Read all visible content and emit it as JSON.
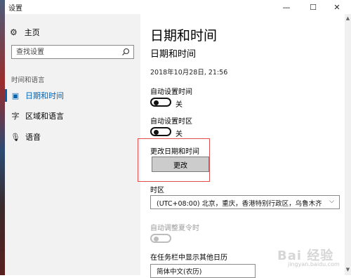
{
  "window": {
    "title": "设置",
    "controls": {
      "minimize": "—",
      "maximize": "☐",
      "close": "✕"
    }
  },
  "sidebar": {
    "home_label": "主页",
    "search": {
      "placeholder": "查找设置"
    },
    "section_label": "时间和语言",
    "items": [
      {
        "label": "日期和时间",
        "icon": "calendar-clock-icon",
        "active": true
      },
      {
        "label": "区域和语言",
        "icon": "language-icon",
        "active": false
      },
      {
        "label": "语音",
        "icon": "microphone-icon",
        "active": false
      }
    ]
  },
  "main": {
    "page_title": "日期和时间",
    "section_title": "日期和时间",
    "current_datetime": "2018年10月28日, 21:56",
    "auto_time": {
      "label": "自动设置时间",
      "state": "关",
      "on": false
    },
    "auto_timezone": {
      "label": "自动设置时区",
      "state": "关",
      "on": false
    },
    "change_datetime": {
      "label": "更改日期和时间",
      "button": "更改"
    },
    "timezone": {
      "label": "时区",
      "value": "(UTC+08:00) 北京，重庆，香港特别行政区，乌鲁木齐"
    },
    "dst": {
      "label": "自动调整夏令时",
      "enabled": false
    },
    "taskbar_calendar": {
      "label": "在任务栏中显示其他日历",
      "value": "简体中文(农历)"
    }
  },
  "watermark": {
    "text": "Bai 经验",
    "sub": "jingyan.baidu.com"
  },
  "colors": {
    "accent": "#0063b1",
    "highlight_box": "#e05050",
    "sidebar_bg": "#f2f2f2"
  }
}
